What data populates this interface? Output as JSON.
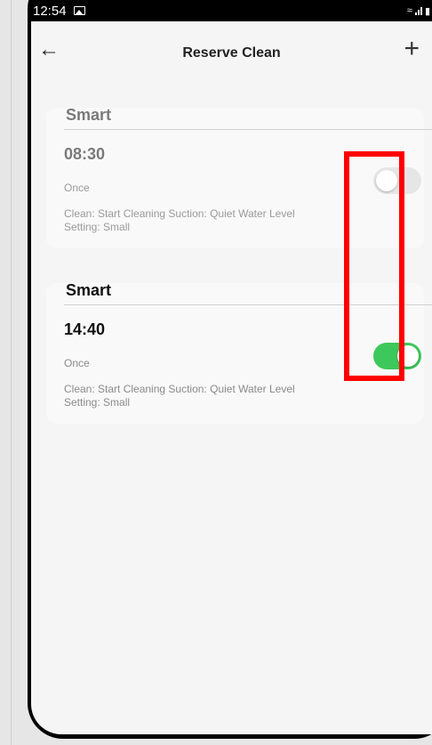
{
  "status_bar": {
    "time": "12:54",
    "icons": [
      "image-icon",
      "wifi-icon",
      "signal-icon",
      "battery-icon"
    ]
  },
  "header": {
    "title": "Reserve Clean",
    "back_icon": "arrow-left-icon",
    "add_icon": "plus-icon"
  },
  "schedules": [
    {
      "name": "Smart",
      "time": "08:30",
      "frequency": "Once",
      "details": "Clean: Start Cleaning  Suction: Quiet  Water Level Setting: Small",
      "enabled": false
    },
    {
      "name": "Smart",
      "time": "14:40",
      "frequency": "Once",
      "details": "Clean: Start Cleaning  Suction: Quiet  Water Level Setting: Small",
      "enabled": true
    }
  ],
  "colors": {
    "toggle_on": "#3dc85c",
    "toggle_off": "#e6e6e6",
    "highlight": "#ff0000",
    "background": "#f5f5f5"
  }
}
